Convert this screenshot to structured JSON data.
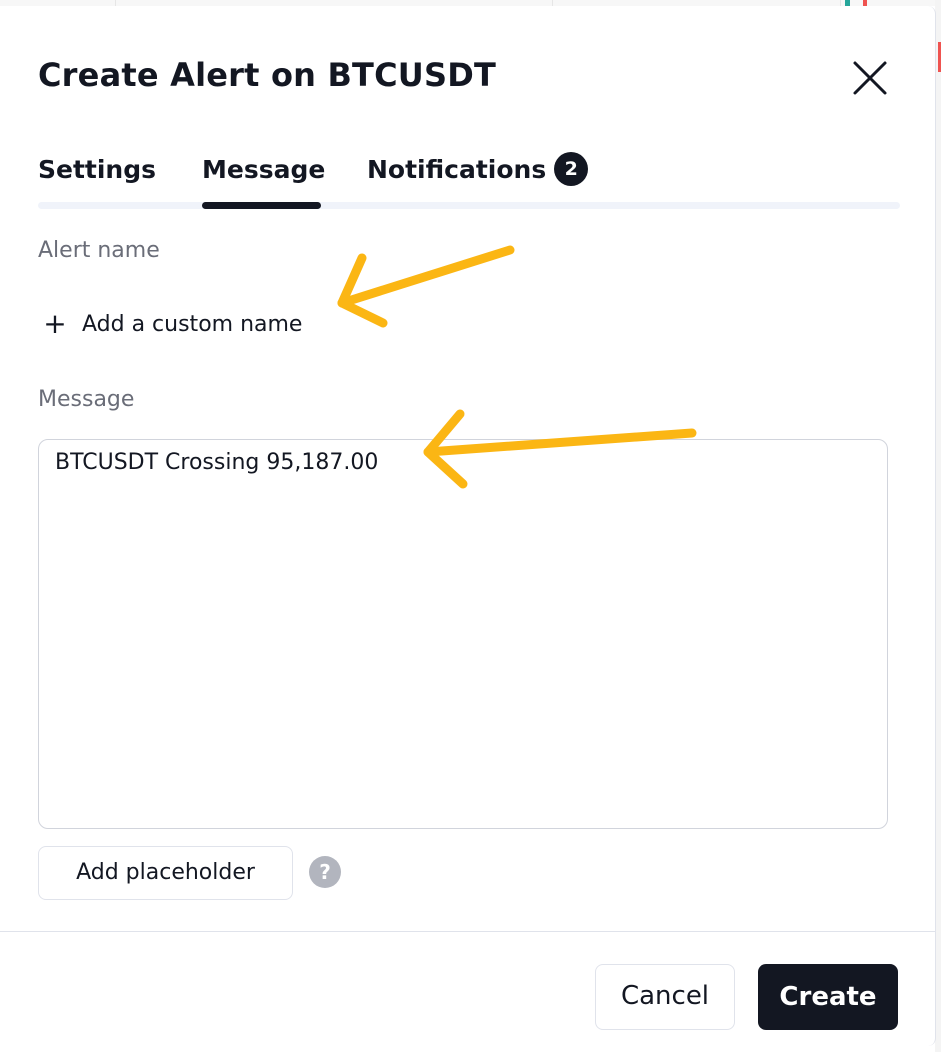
{
  "dialog": {
    "title": "Create Alert on BTCUSDT",
    "close_icon": "close-icon"
  },
  "tabs": [
    {
      "label": "Settings",
      "active": false
    },
    {
      "label": "Message",
      "active": true
    },
    {
      "label": "Notifications",
      "active": false,
      "badge": "2"
    }
  ],
  "alert_name": {
    "label": "Alert name",
    "add_button_label": "Add a custom name",
    "add_icon": "plus-icon"
  },
  "message": {
    "label": "Message",
    "value": "BTCUSDT Crossing 95,187.00"
  },
  "placeholder": {
    "button_label": "Add placeholder",
    "help_icon": "help-icon",
    "help_glyph": "?"
  },
  "footer": {
    "cancel_label": "Cancel",
    "create_label": "Create"
  },
  "annotations": {
    "arrow_color": "#fbb614",
    "arrows": [
      "arrow-icon",
      "arrow-icon"
    ]
  },
  "colors": {
    "primary": "#131722",
    "label": "#6a6d78",
    "border": "#d1d4dc",
    "help_icon_bg": "#b2b5be"
  }
}
